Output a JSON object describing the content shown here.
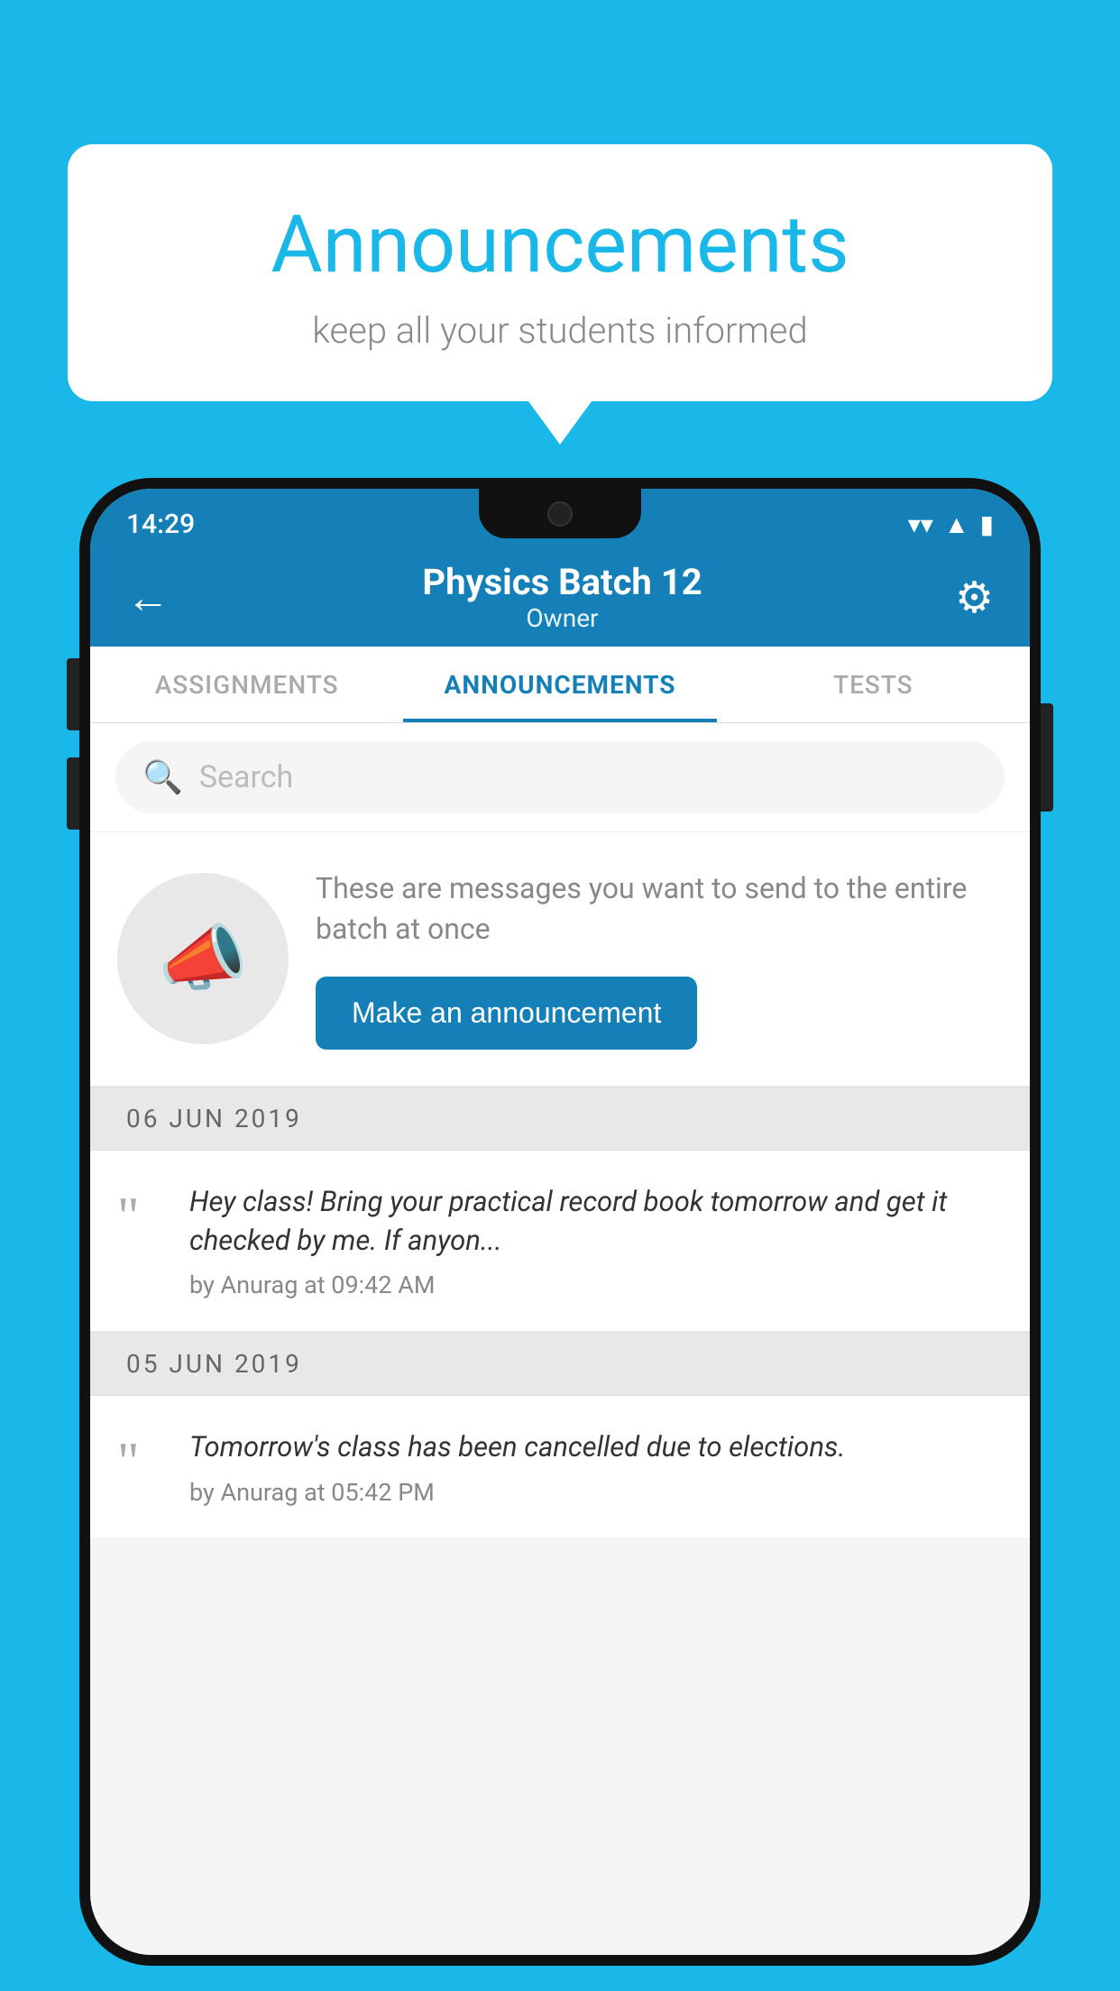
{
  "background_color": "#1ab8e8",
  "speech_bubble": {
    "title": "Announcements",
    "subtitle": "keep all your students informed"
  },
  "phone": {
    "status_bar": {
      "time": "14:29",
      "wifi_icon": "▼",
      "signal_icon": "▲",
      "battery_icon": "▮"
    },
    "header": {
      "back_label": "←",
      "title": "Physics Batch 12",
      "subtitle": "Owner",
      "gear_label": "⚙"
    },
    "tabs": [
      {
        "label": "ASSIGNMENTS",
        "active": false
      },
      {
        "label": "ANNOUNCEMENTS",
        "active": true
      },
      {
        "label": "TESTS",
        "active": false
      }
    ],
    "search": {
      "placeholder": "Search"
    },
    "announcement_info": {
      "description": "These are messages you want to send to the entire batch at once",
      "button_label": "Make an announcement"
    },
    "announcements": [
      {
        "date": "06  JUN  2019",
        "text": "Hey class! Bring your practical record book tomorrow and get it checked by me. If anyon...",
        "meta": "by Anurag at 09:42 AM"
      },
      {
        "date": "05  JUN  2019",
        "text": "Tomorrow's class has been cancelled due to elections.",
        "meta": "by Anurag at 05:42 PM"
      }
    ]
  }
}
